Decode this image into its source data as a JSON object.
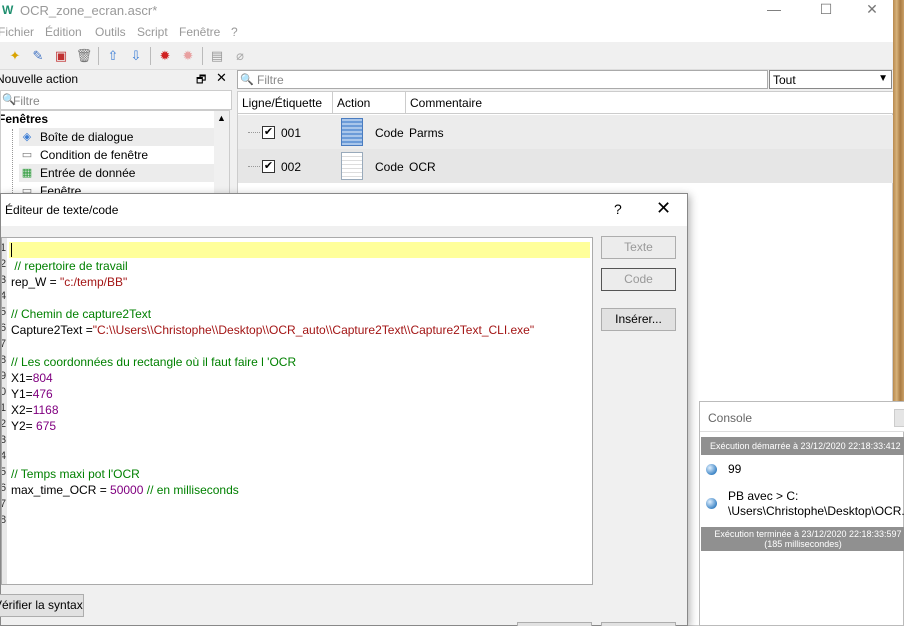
{
  "window": {
    "title": "OCR_zone_ecran.ascr*",
    "icon": "app-logo-icon",
    "min_glyph": "—",
    "max_glyph": "☐",
    "close_glyph": "✕"
  },
  "menu": [
    "Fichier",
    "Édition",
    "Outils",
    "Script",
    "Fenêtre",
    "?"
  ],
  "left_panel": {
    "title": "Nouvelle action",
    "restore_glyph": "🗗",
    "close_glyph": "✕",
    "filter_placeholder": "Filtre",
    "category": "Fenêtres",
    "items": [
      {
        "label": "Boîte de dialogue",
        "icon": "dialog-icon"
      },
      {
        "label": "Condition de fenêtre",
        "icon": "window-condition-icon"
      },
      {
        "label": "Entrée de donnée",
        "icon": "data-entry-icon"
      },
      {
        "label": "Fenêtre",
        "icon": "window-icon"
      }
    ]
  },
  "right_panel": {
    "filter_placeholder": "Filtre",
    "filter_select": "Tout",
    "columns": [
      "Ligne/Étiquette",
      "Action",
      "Commentaire"
    ],
    "rows": [
      {
        "num": "001",
        "action": "Code",
        "comment": "Parms",
        "checked": "✔"
      },
      {
        "num": "002",
        "action": "Code",
        "comment": "OCR",
        "checked": "✔"
      }
    ]
  },
  "dialog": {
    "title": "Éditeur de texte/code",
    "help_glyph": "?",
    "close_glyph": "✕",
    "buttons": {
      "texte": "Texte",
      "code": "Code",
      "inserer": "Insérer..."
    },
    "verify_label": "Vérifier la syntaxe",
    "line_numbers": [
      "1",
      "2",
      "3",
      "4",
      "5",
      "6",
      "7",
      "8",
      "9",
      "0",
      "1",
      "2",
      "3",
      "4",
      "5",
      "6",
      "7",
      "8"
    ],
    "code": {
      "l2": " // repertoire de travail",
      "l3_var": "rep_W = ",
      "l3_str": "\"c:/temp/BB\"",
      "l5": "// Chemin de capture2Text",
      "l6_var": "Capture2Text =",
      "l6_str": "\"C:\\\\Users\\\\Christophe\\\\Desktop\\\\OCR_auto\\\\Capture2Text\\\\Capture2Text_CLI.exe\"",
      "l8": "// Les coordonnées du rectangle où il faut faire l 'OCR",
      "x1_var": "X1=",
      "x1_num": "804",
      "y1_var": "Y1=",
      "y1_num": "476",
      "x2_var": "X2=",
      "x2_num": "1168",
      "y2_var": "Y2= ",
      "y2_num": "675",
      "l15": "// Temps maxi pot l'OCR",
      "l16_var": "max_time_OCR = ",
      "l16_num": "50000",
      "l16_com": " // en milliseconds"
    }
  },
  "console": {
    "title": "Console",
    "start": "Exécution démarrée à 23/12/2020 22:18:33:412",
    "msg1": "99",
    "msg2_line1": "PB avec > C:",
    "msg2_line2": "\\Users\\Christophe\\Desktop\\OCR...",
    "end_line1": "Exécution terminée à 23/12/2020 22:18:33:597",
    "end_line2": "(185 millisecondes)"
  },
  "toolbar_icons": [
    "new-icon",
    "edit-icon",
    "run-icon",
    "delete-icon",
    "up-arrow-icon",
    "down-arrow-icon",
    "record-icon",
    "record-disabled-icon",
    "notes-icon",
    "attach-icon"
  ],
  "colors": {
    "current_line": "#ffff9a",
    "comment": "#008000",
    "string": "#a31515",
    "number": "#800080"
  }
}
